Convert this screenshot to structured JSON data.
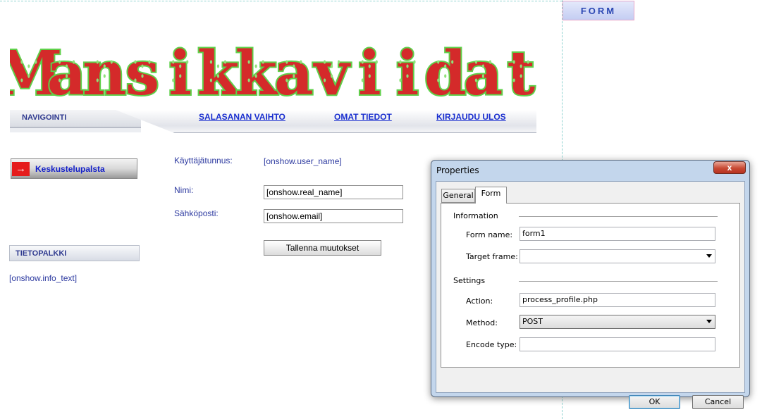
{
  "form_badge": "FORM",
  "logo": {
    "text": "Mansikkaviidat"
  },
  "nav": {
    "title": "NAVIGOINTI",
    "links": [
      "SALASANAN VAIHTO",
      "OMAT TIEDOT",
      "KIRJAUDU ULOS"
    ]
  },
  "sidebar": {
    "button_label": "Keskustelupalsta",
    "button_icon": "arrow-right-icon",
    "infobar_title": "TIETOPALKKI",
    "info_text": "[onshow.info_text]"
  },
  "profile_form": {
    "username_label": "Käyttäjätunnus:",
    "username_value": "[onshow.user_name]",
    "name_label": "Nimi:",
    "name_value": "[onshow.real_name]",
    "email_label": "Sähköposti:",
    "email_value": "[onshow.email]",
    "save_label": "Tallenna muutokset"
  },
  "dialog": {
    "title": "Properties",
    "close_label": "x",
    "tabs": [
      "General",
      "Form"
    ],
    "active_tab": "Form",
    "information_group": "Information",
    "form_name_label": "Form name:",
    "form_name_value": "form1",
    "target_frame_label": "Target frame:",
    "target_frame_value": "",
    "settings_group": "Settings",
    "action_label": "Action:",
    "action_value": "process_profile.php",
    "method_label": "Method:",
    "method_value": "POST",
    "encode_type_label": "Encode type:",
    "encode_type_value": "",
    "ok_label": "OK",
    "cancel_label": "Cancel"
  },
  "colors": {
    "link_blue": "#1a2fcf",
    "label_blue": "#2d3aa0",
    "strawberry_red": "#d42a2a",
    "outline_green": "#5fd04a",
    "arrow_red": "#e51c1c"
  }
}
